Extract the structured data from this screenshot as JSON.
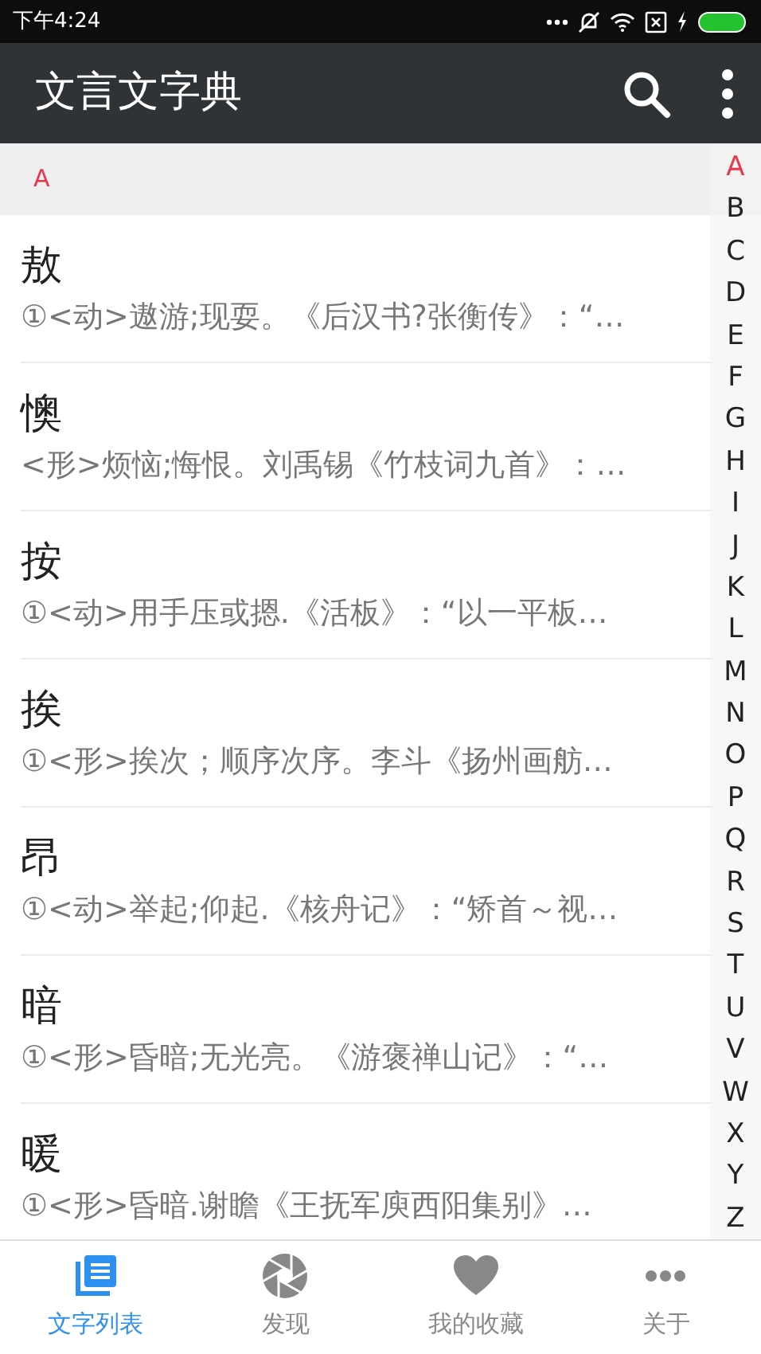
{
  "status_bar": {
    "time": "下午4:24"
  },
  "app_bar": {
    "title": "文言文字典"
  },
  "section": {
    "header": "A"
  },
  "entries": [
    {
      "character": "敖",
      "definition": "①<动>遨游;现耍。《后汉书?张衡传》：“…"
    },
    {
      "character": "懊",
      "definition": "<形>烦恼;悔恨。刘禹锡《竹枝词九首》：…"
    },
    {
      "character": "按",
      "definition": "①<动>用手压或摁.《活板》：“以一平板…"
    },
    {
      "character": "挨",
      "definition": "①<形>挨次；顺序次序。李斗《扬州画舫…"
    },
    {
      "character": "昂",
      "definition": "①<动>举起;仰起.《核舟记》：“矫首～视…"
    },
    {
      "character": "暗",
      "definition": "①<形>昏暗;无光亮。《游褒禅山记》：“…"
    },
    {
      "character": "暖",
      "definition": "①<形>昏暗.谢瞻《王抚军庾西阳集别》…"
    }
  ],
  "index_bar": [
    {
      "letter": "A",
      "selected": true
    },
    {
      "letter": "B",
      "selected": false
    },
    {
      "letter": "C",
      "selected": false
    },
    {
      "letter": "D",
      "selected": false
    },
    {
      "letter": "E",
      "selected": false
    },
    {
      "letter": "F",
      "selected": false
    },
    {
      "letter": "G",
      "selected": false
    },
    {
      "letter": "H",
      "selected": false
    },
    {
      "letter": "I",
      "selected": false
    },
    {
      "letter": "J",
      "selected": false
    },
    {
      "letter": "K",
      "selected": false
    },
    {
      "letter": "L",
      "selected": false
    },
    {
      "letter": "M",
      "selected": false
    },
    {
      "letter": "N",
      "selected": false
    },
    {
      "letter": "O",
      "selected": false
    },
    {
      "letter": "P",
      "selected": false
    },
    {
      "letter": "Q",
      "selected": false
    },
    {
      "letter": "R",
      "selected": false
    },
    {
      "letter": "S",
      "selected": false
    },
    {
      "letter": "T",
      "selected": false
    },
    {
      "letter": "U",
      "selected": false
    },
    {
      "letter": "V",
      "selected": false
    },
    {
      "letter": "W",
      "selected": false
    },
    {
      "letter": "X",
      "selected": false
    },
    {
      "letter": "Y",
      "selected": false
    },
    {
      "letter": "Z",
      "selected": false
    }
  ],
  "bottom_nav": [
    {
      "kind": "list",
      "label": "文字列表",
      "selected": true
    },
    {
      "kind": "discover",
      "label": "发现",
      "selected": false
    },
    {
      "kind": "favorites",
      "label": "我的收藏",
      "selected": false
    },
    {
      "kind": "about",
      "label": "关于",
      "selected": false
    }
  ]
}
